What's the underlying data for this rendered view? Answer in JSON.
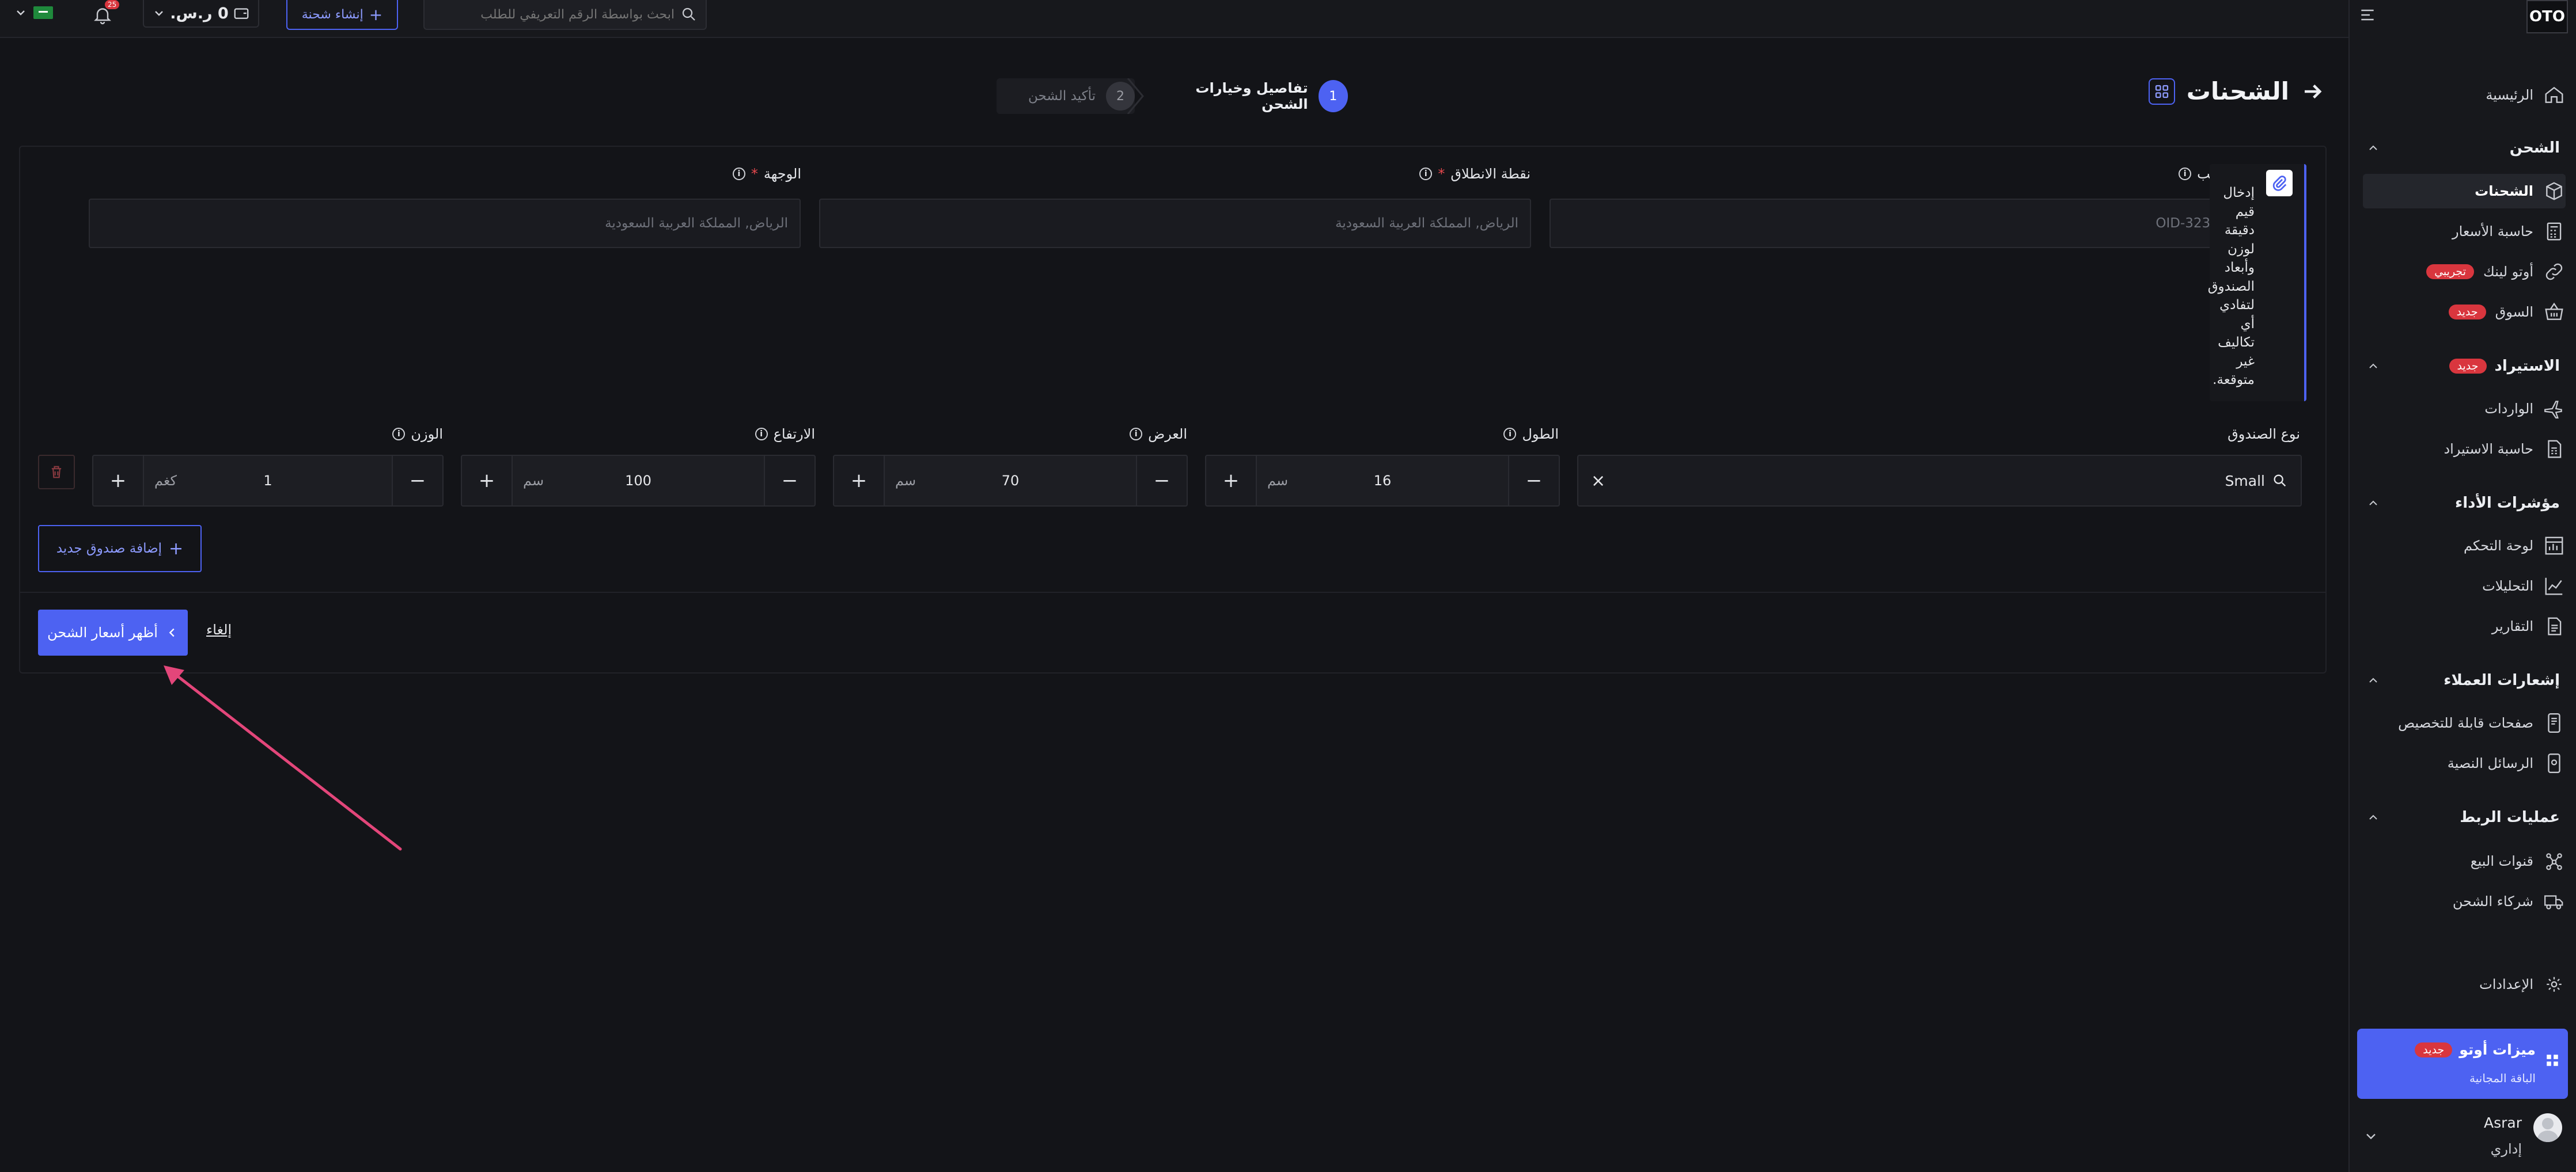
{
  "topbar": {
    "search_placeholder": "ابحث بواسطة الرقم التعريفي للطلب",
    "create_shipment": "إنشاء شحنة",
    "wallet_balance": "0 ر.س.",
    "notification_count": "25"
  },
  "sidebar": {
    "logo": "OTO",
    "home": "الرئيسية",
    "shipping_section": "الشحن",
    "shipping_items": [
      {
        "label": "الشحنات"
      },
      {
        "label": "حاسبة الأسعار"
      },
      {
        "label": "أوتو لينك",
        "badge": "تجريبي"
      },
      {
        "label": "السوق",
        "badge": "جديد"
      }
    ],
    "import_section": "الاستيراد",
    "import_badge": "جديد",
    "import_items": [
      {
        "label": "الواردات"
      },
      {
        "label": "حاسبة الاستيراد"
      }
    ],
    "kpi_section": "مؤشرات الأداء",
    "kpi_items": [
      {
        "label": "لوحة التحكم"
      },
      {
        "label": "التحليلات"
      },
      {
        "label": "التقارير"
      }
    ],
    "notif_section": "إشعارات العملاء",
    "notif_items": [
      {
        "label": "صفحات قابلة للتخصيص"
      },
      {
        "label": "الرسائل النصية"
      }
    ],
    "integrations_section": "عمليات الربط",
    "integration_items": [
      {
        "label": "قنوات البيع"
      },
      {
        "label": "شركاء الشحن"
      }
    ],
    "settings": "الإعدادات",
    "promo_title": "ميزات أوتو",
    "promo_badge": "جديد",
    "promo_sub": "الباقة المجانية",
    "user_name": "Asrar",
    "user_role": "إداري"
  },
  "page": {
    "title": "الشحنات",
    "step1_num": "1",
    "step1_label": "تفاصيل وخيارات الشحن",
    "step2_num": "2",
    "step2_label": "تأكيد الشحن"
  },
  "form": {
    "order_id_label": "رقم الطلب",
    "order_id_placeholder": "OID-32305-10",
    "tooltip_words": [
      "إدخال",
      "قيم",
      "دقيقة",
      "لوزن",
      "وأبعاد",
      "الصندوق",
      "لتفادي",
      "أي",
      "تكاليف",
      "غير",
      "متوقعة."
    ],
    "origin_label": "نقطة الانطلاق",
    "origin_placeholder": "الرياض, المملكة العربية السعودية",
    "destination_label": "الوجهة",
    "destination_placeholder": "الرياض, المملكة العربية السعودية",
    "required_mark": "*",
    "box_type_label": "نوع الصندوق",
    "box_type_value": "Small",
    "length_label": "الطول",
    "length_value": "16",
    "width_label": "العرض",
    "width_value": "70",
    "height_label": "الارتفاع",
    "height_value": "100",
    "weight_label": "الوزن",
    "weight_value": "1",
    "unit_cm": "سم",
    "unit_kg": "كغم",
    "add_box": "إضافة صندوق جديد",
    "show_rates": "أظهر أسعار الشحن",
    "cancel": "إلغاء"
  },
  "colors": {
    "accent": "#4d62f2",
    "danger": "#d9363e",
    "arrow": "#e3467a"
  }
}
